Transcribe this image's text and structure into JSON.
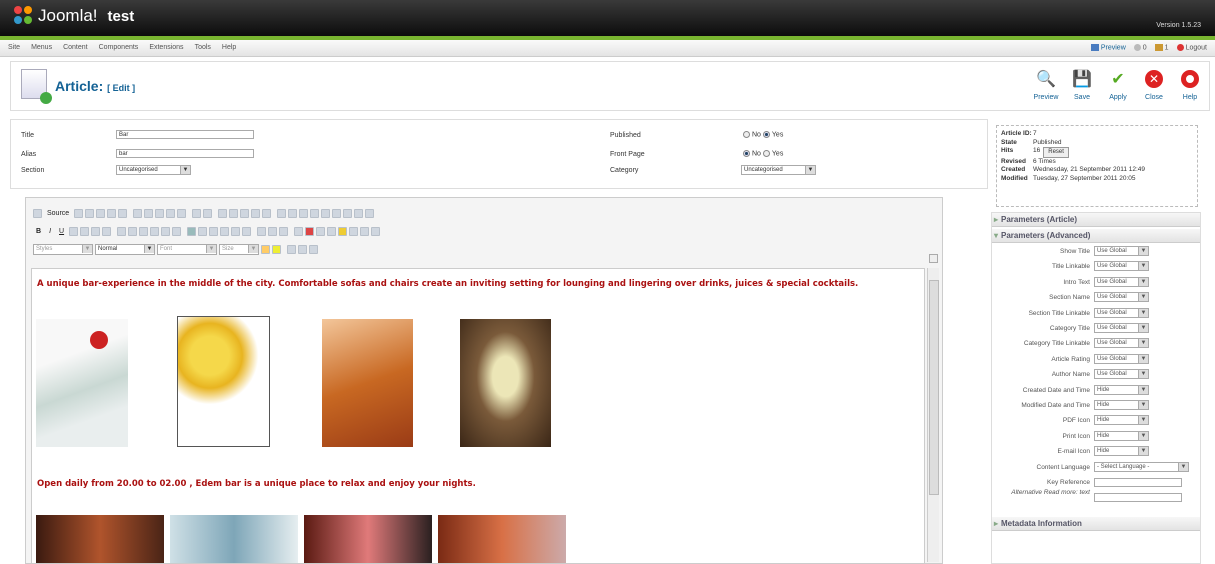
{
  "app": {
    "brand": "Joomla!",
    "site": "test",
    "version": "Version 1.5.23"
  },
  "menu": [
    "Site",
    "Menus",
    "Content",
    "Components",
    "Extensions",
    "Tools",
    "Help"
  ],
  "status": {
    "preview": "Preview",
    "messages": "0",
    "users": "1",
    "logout": "Logout"
  },
  "page": {
    "title": "Article:",
    "subtitle": "[ Edit ]"
  },
  "toolbar": [
    {
      "label": "Preview",
      "icon": "preview-icon"
    },
    {
      "label": "Save",
      "icon": "save-icon"
    },
    {
      "label": "Apply",
      "icon": "apply-icon"
    },
    {
      "label": "Close",
      "icon": "close-icon"
    },
    {
      "label": "Help",
      "icon": "help-icon"
    }
  ],
  "form": {
    "title_label": "Title",
    "title_value": "Bar",
    "alias_label": "Alias",
    "alias_value": "bar",
    "section_label": "Section",
    "section_value": "Uncategorised",
    "published_label": "Published",
    "frontpage_label": "Front Page",
    "category_label": "Category",
    "category_value": "Uncategorised",
    "no": "No",
    "yes": "Yes"
  },
  "editor": {
    "source": "Source",
    "styles": "Styles",
    "format": "Normal",
    "font": "Font",
    "size": "Size",
    "para1": "A unique bar-experience in the middle of the city. Comfortable sofas and chairs create an inviting setting for lounging  and lingering over drinks, juices & special cocktails.",
    "para2": "Open daily from 20.00 to 02.00 , Edem bar is a unique place to relax and enjoy your nights."
  },
  "meta": {
    "id_label": "Article ID:",
    "id": "7",
    "state_label": "State",
    "state": "Published",
    "hits_label": "Hits",
    "hits": "16",
    "reset": "Reset",
    "revised_label": "Revised",
    "revised": "6 Times",
    "created_label": "Created",
    "created": "Wednesday, 21 September 2011 12:49",
    "modified_label": "Modified",
    "modified": "Tuesday, 27 September 2011 20:05"
  },
  "panels": {
    "article": "Parameters (Article)",
    "advanced": "Parameters (Advanced)",
    "metadata": "Metadata Information"
  },
  "params": [
    {
      "label": "Show Title",
      "value": "Use Global"
    },
    {
      "label": "Title Linkable",
      "value": "Use Global"
    },
    {
      "label": "Intro Text",
      "value": "Use Global"
    },
    {
      "label": "Section Name",
      "value": "Use Global"
    },
    {
      "label": "Section Title Linkable",
      "value": "Use Global"
    },
    {
      "label": "Category Title",
      "value": "Use Global"
    },
    {
      "label": "Category Title Linkable",
      "value": "Use Global"
    },
    {
      "label": "Article Rating",
      "value": "Use Global"
    },
    {
      "label": "Author Name",
      "value": "Use Global"
    },
    {
      "label": "Created Date and Time",
      "value": "Hide"
    },
    {
      "label": "Modified Date and Time",
      "value": "Hide"
    },
    {
      "label": "PDF Icon",
      "value": "Hide"
    },
    {
      "label": "Print Icon",
      "value": "Hide"
    },
    {
      "label": "E-mail Icon",
      "value": "Hide"
    },
    {
      "label": "Content Language",
      "value": "- Select Language -"
    },
    {
      "label": "Key Reference",
      "value": ""
    },
    {
      "label": "Alternative Read more: text",
      "value": ""
    }
  ]
}
